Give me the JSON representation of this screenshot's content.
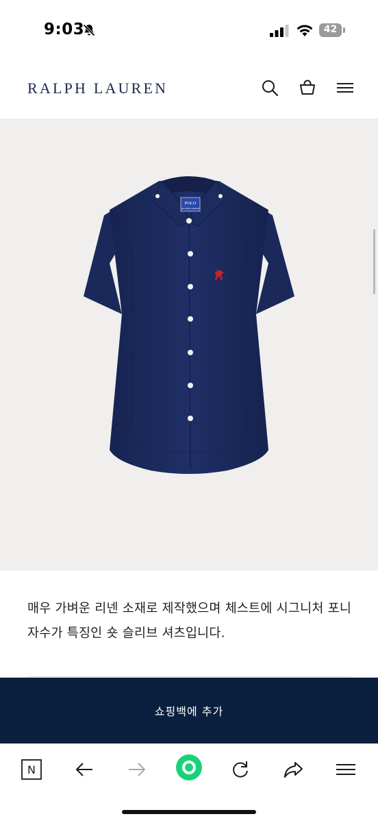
{
  "status_bar": {
    "time": "9:03",
    "battery": "42"
  },
  "header": {
    "brand": "RALPH LAUREN"
  },
  "product": {
    "description": "매우 가벼운 리넨 소재로 제작했으며 체스트에 시그니처 포니 자수가 특징인 숏 슬리브 셔츠입니다.",
    "label_line1": "POLO",
    "label_line2": "RALPH LAUREN",
    "colors": {
      "shirt": "#1b2a5c",
      "background": "#f0efed",
      "pony": "#c4232b"
    }
  },
  "cta": {
    "add_to_bag": "쇼핑백에 추가",
    "background": "#0b1f3f"
  },
  "browser_toolbar": {
    "n_label": "N",
    "items": [
      "n-icon",
      "back-arrow-icon",
      "forward-arrow-icon",
      "green-home-icon",
      "reload-icon",
      "share-icon",
      "tabs-menu-icon"
    ],
    "accent": "#18d27a"
  }
}
